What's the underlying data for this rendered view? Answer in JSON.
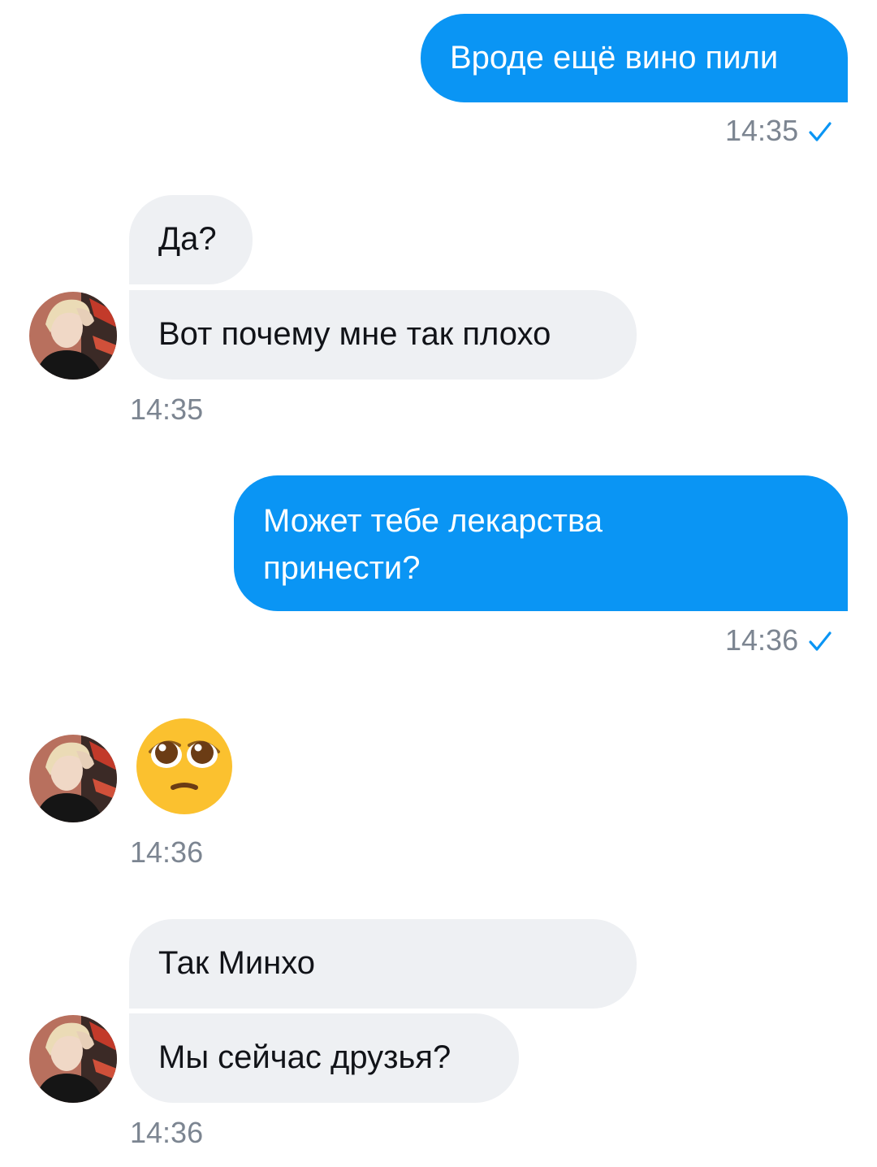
{
  "messages": [
    {
      "direction": "out",
      "text": "Вроде ещё вино пили",
      "time": "14:35",
      "status_icon": "check-icon"
    },
    {
      "direction": "in",
      "text": "Да?"
    },
    {
      "direction": "in",
      "text": "Вот почему мне так плохо",
      "time": "14:35"
    },
    {
      "direction": "out",
      "text_lines": [
        "Может тебе лекарства",
        "принести?"
      ],
      "time": "14:36",
      "status_icon": "check-icon"
    },
    {
      "direction": "in",
      "emoji": "pleading-face-icon",
      "time": "14:36"
    },
    {
      "direction": "in",
      "text": "Так Минхо"
    },
    {
      "direction": "in",
      "text": "Мы сейчас друзья?",
      "time": "14:36"
    }
  ],
  "colors": {
    "outgoing_bubble": "#0a95f4",
    "incoming_bubble": "#eef0f3",
    "timestamp": "#7c8591",
    "checkmark": "#0a95f4"
  }
}
